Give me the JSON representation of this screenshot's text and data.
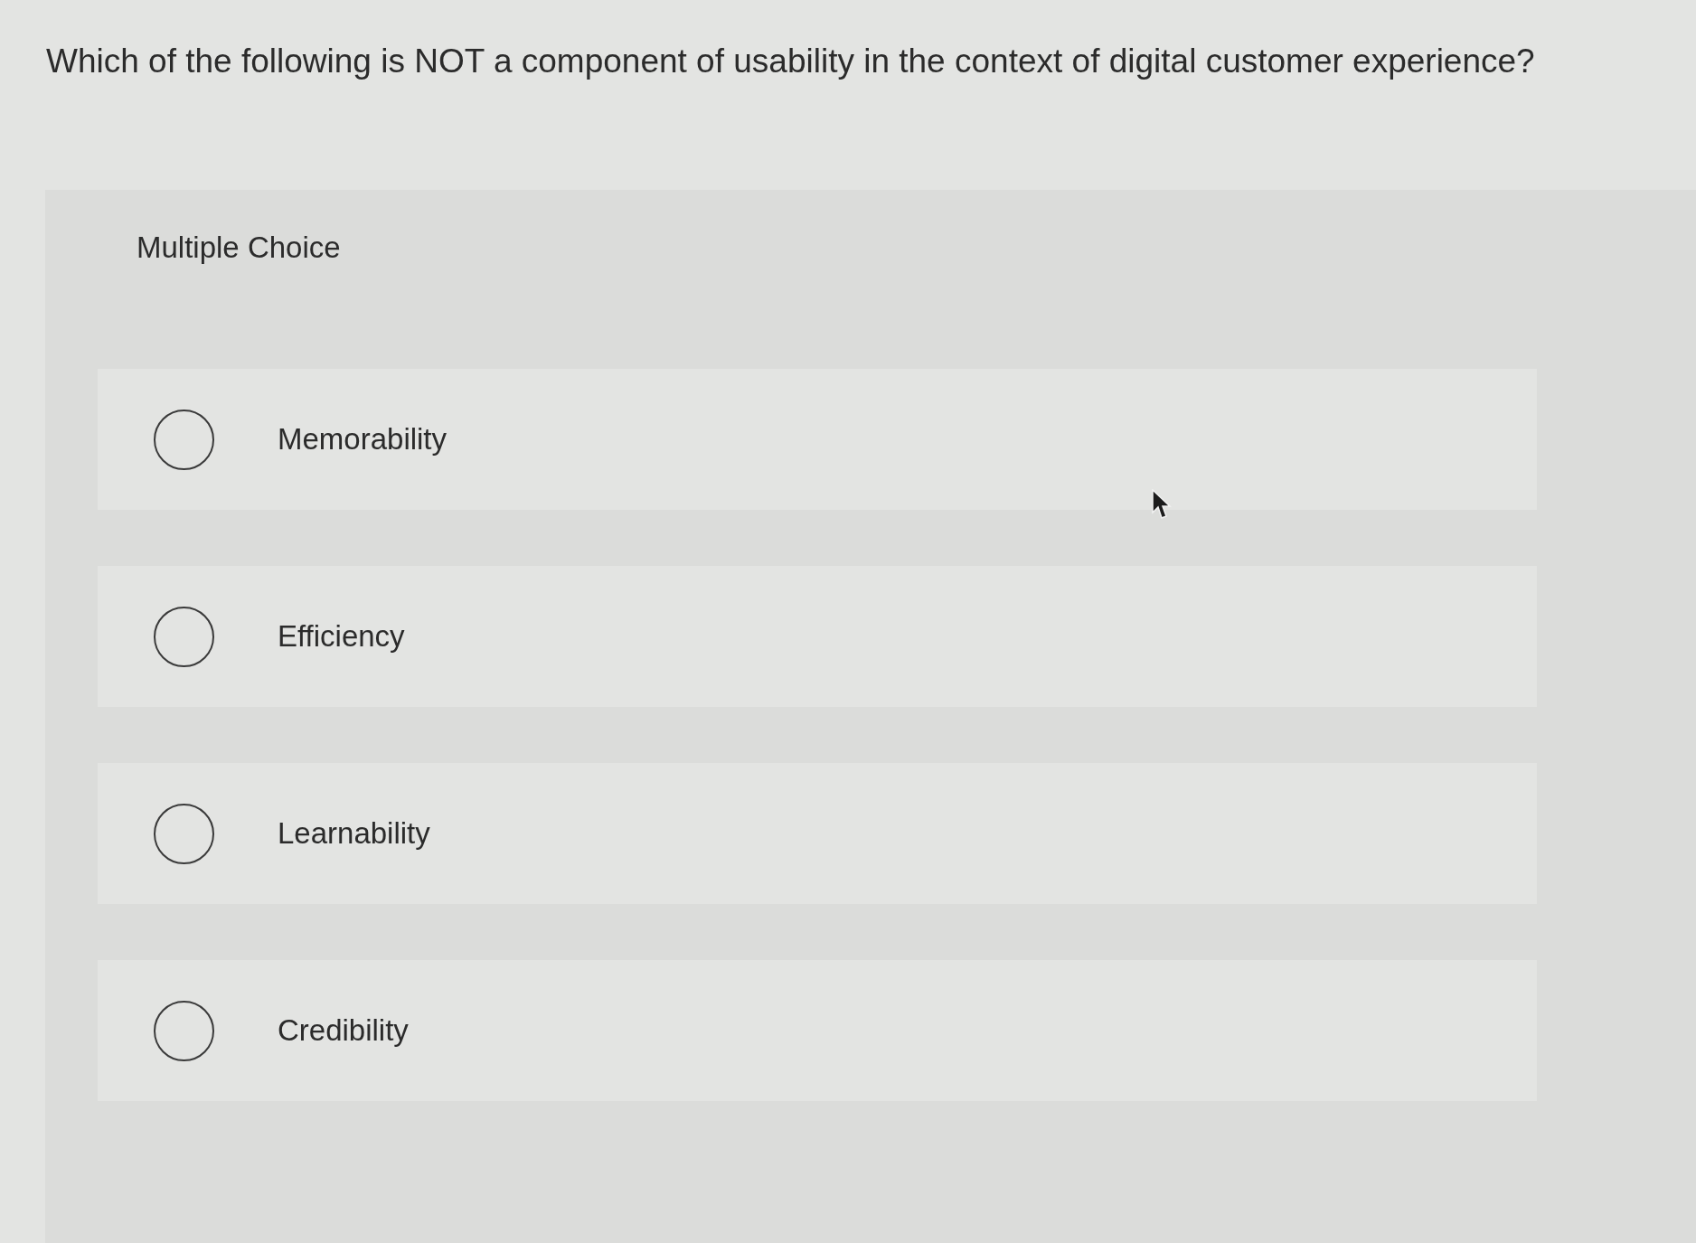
{
  "question": "Which of the following is NOT a component of usability in the context of digital customer experience?",
  "panel": {
    "label": "Multiple Choice"
  },
  "options": [
    {
      "label": "Memorability",
      "selected": false
    },
    {
      "label": "Efficiency",
      "selected": false
    },
    {
      "label": "Learnability",
      "selected": false
    },
    {
      "label": "Credibility",
      "selected": false
    }
  ]
}
